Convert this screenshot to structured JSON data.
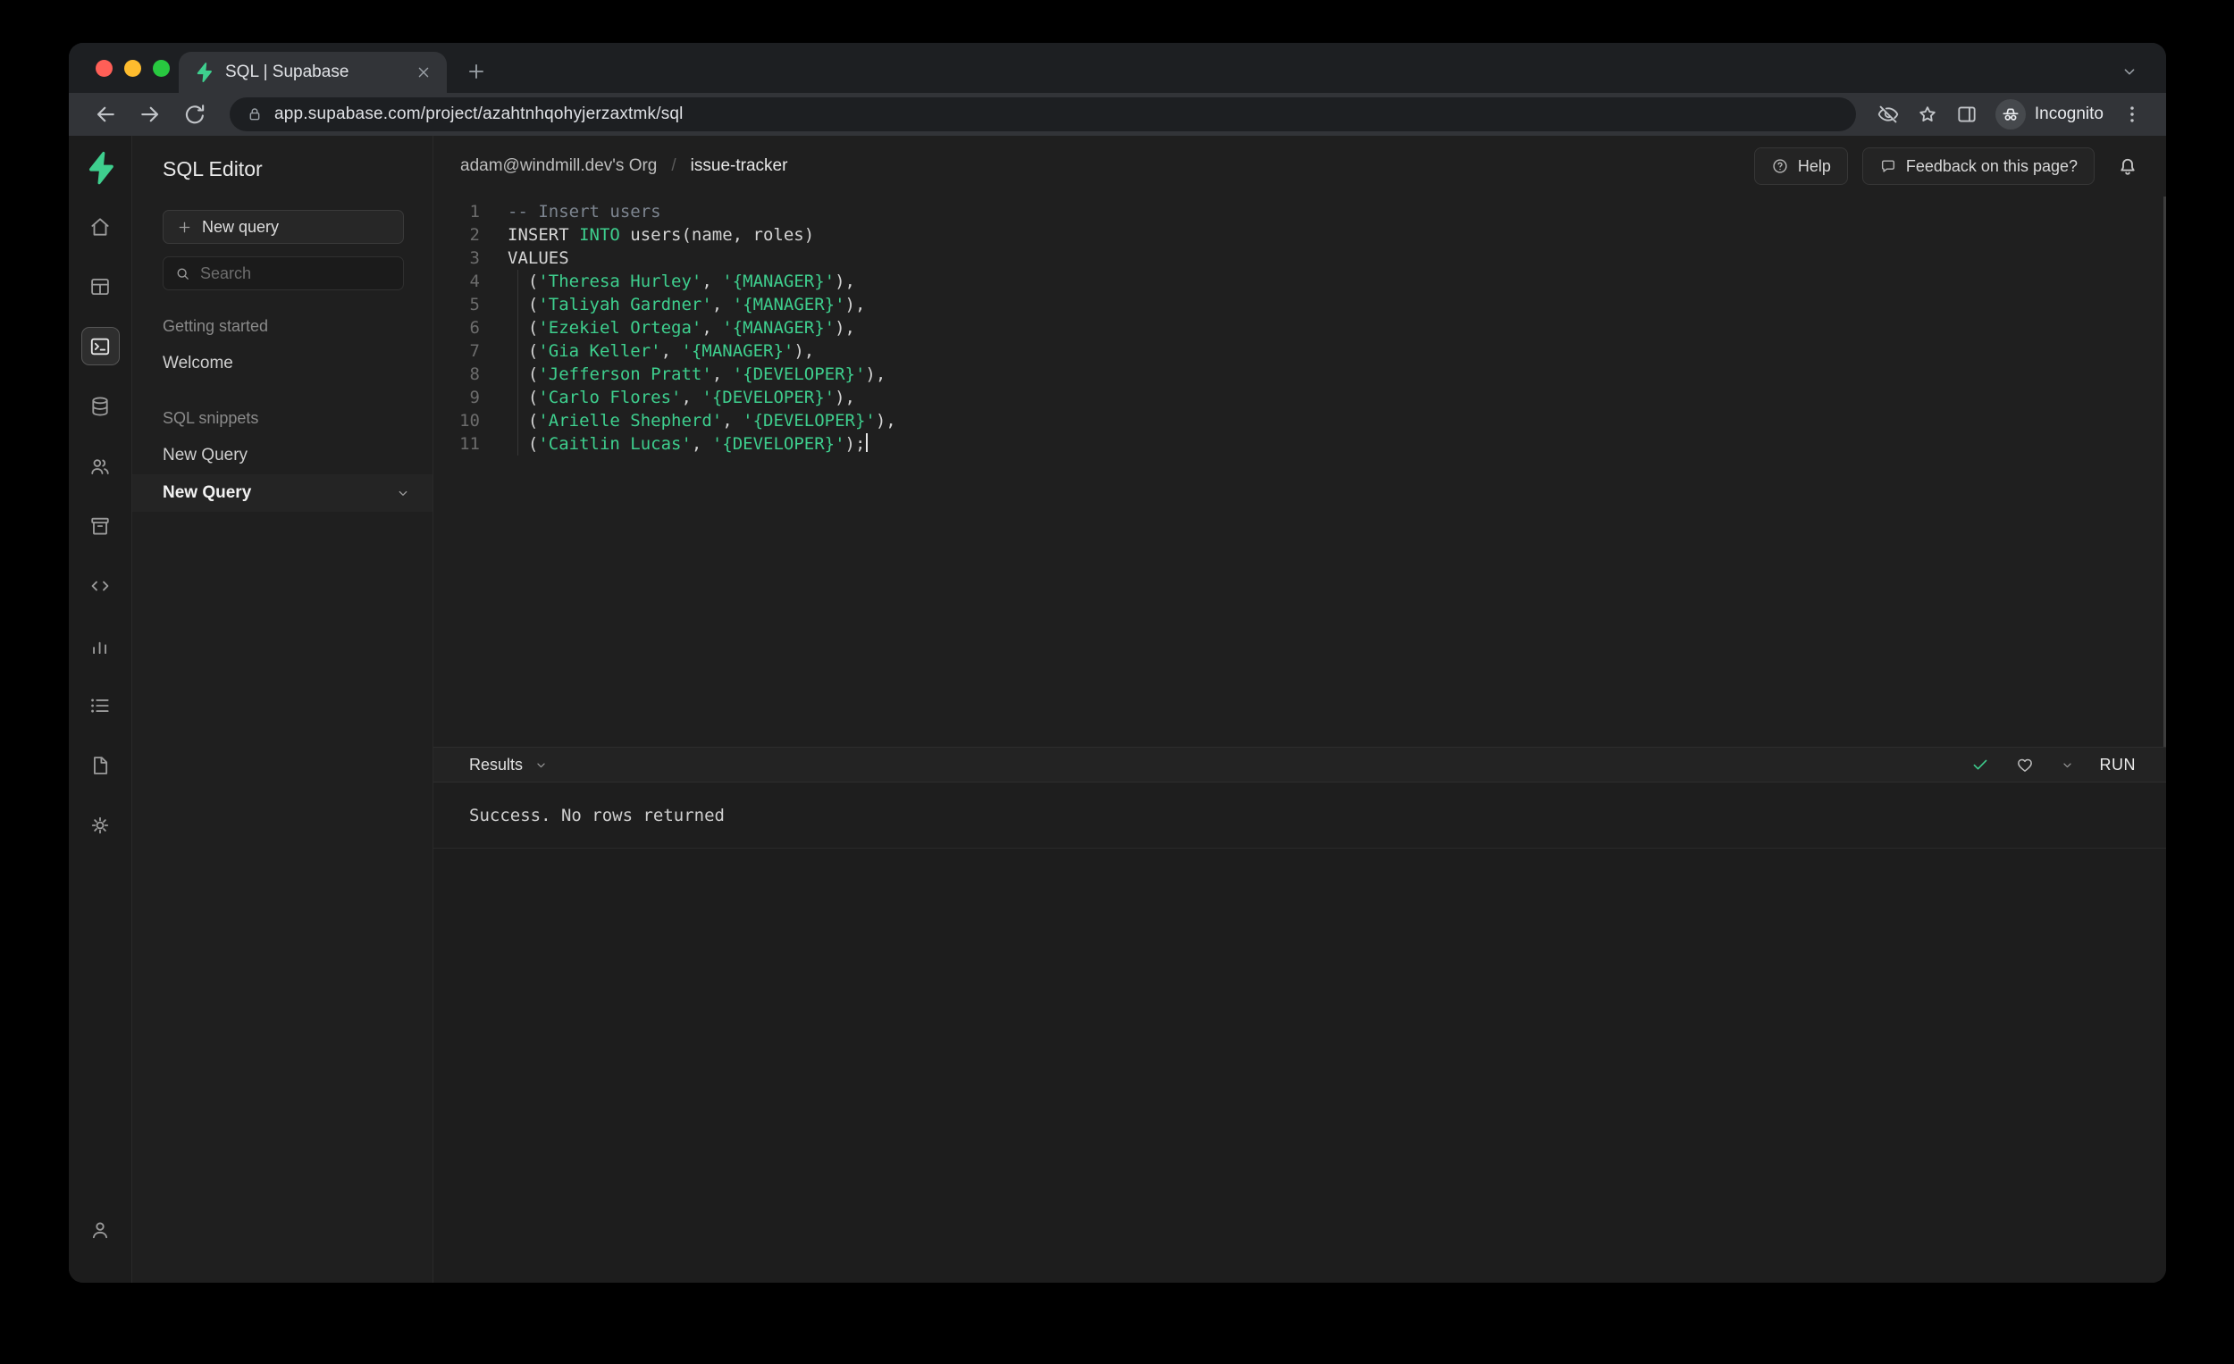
{
  "browser": {
    "tab_title": "SQL | Supabase",
    "url": "app.supabase.com/project/azahtnhqohyjerzaxtmk/sql",
    "incognito_label": "Incognito"
  },
  "rail": {
    "items": [
      {
        "name": "home"
      },
      {
        "name": "table-editor"
      },
      {
        "name": "sql-editor",
        "selected": true
      },
      {
        "name": "database"
      },
      {
        "name": "authentication"
      },
      {
        "name": "storage"
      },
      {
        "name": "api"
      },
      {
        "name": "reports"
      },
      {
        "name": "logs"
      },
      {
        "name": "docs"
      },
      {
        "name": "settings"
      }
    ]
  },
  "sidebar": {
    "title": "SQL Editor",
    "new_query_button": "New query",
    "search_placeholder": "Search",
    "sections": [
      {
        "label": "Getting started",
        "items": [
          {
            "label": "Welcome",
            "selected": false
          }
        ]
      },
      {
        "label": "SQL snippets",
        "items": [
          {
            "label": "New Query",
            "selected": false
          },
          {
            "label": "New Query",
            "selected": true
          }
        ]
      }
    ]
  },
  "topbar": {
    "org": "adam@windmill.dev's Org",
    "project": "issue-tracker",
    "help_label": "Help",
    "feedback_label": "Feedback on this page?"
  },
  "editor": {
    "cursor_line": 11,
    "lines": [
      [
        [
          "-- Insert users",
          "c"
        ]
      ],
      [
        [
          "INSERT ",
          "k"
        ],
        [
          "INTO",
          "g"
        ],
        [
          " users(name, roles)",
          "p"
        ]
      ],
      [
        [
          "VALUES",
          "k"
        ]
      ],
      [
        [
          "  (",
          "p"
        ],
        [
          "'Theresa Hurley'",
          "s"
        ],
        [
          ", ",
          "p"
        ],
        [
          "'{MANAGER}'",
          "s"
        ],
        [
          "),",
          "p"
        ]
      ],
      [
        [
          "  (",
          "p"
        ],
        [
          "'Taliyah Gardner'",
          "s"
        ],
        [
          ", ",
          "p"
        ],
        [
          "'{MANAGER}'",
          "s"
        ],
        [
          "),",
          "p"
        ]
      ],
      [
        [
          "  (",
          "p"
        ],
        [
          "'Ezekiel Ortega'",
          "s"
        ],
        [
          ", ",
          "p"
        ],
        [
          "'{MANAGER}'",
          "s"
        ],
        [
          "),",
          "p"
        ]
      ],
      [
        [
          "  (",
          "p"
        ],
        [
          "'Gia Keller'",
          "s"
        ],
        [
          ", ",
          "p"
        ],
        [
          "'{MANAGER}'",
          "s"
        ],
        [
          "),",
          "p"
        ]
      ],
      [
        [
          "  (",
          "p"
        ],
        [
          "'Jefferson Pratt'",
          "s"
        ],
        [
          ", ",
          "p"
        ],
        [
          "'{DEVELOPER}'",
          "s"
        ],
        [
          "),",
          "p"
        ]
      ],
      [
        [
          "  (",
          "p"
        ],
        [
          "'Carlo Flores'",
          "s"
        ],
        [
          ", ",
          "p"
        ],
        [
          "'{DEVELOPER}'",
          "s"
        ],
        [
          "),",
          "p"
        ]
      ],
      [
        [
          "  (",
          "p"
        ],
        [
          "'Arielle Shepherd'",
          "s"
        ],
        [
          ", ",
          "p"
        ],
        [
          "'{DEVELOPER}'",
          "s"
        ],
        [
          "),",
          "p"
        ]
      ],
      [
        [
          "  (",
          "p"
        ],
        [
          "'Caitlin Lucas'",
          "s"
        ],
        [
          ", ",
          "p"
        ],
        [
          "'{DEVELOPER}'",
          "s"
        ],
        [
          ");",
          "p"
        ]
      ]
    ]
  },
  "results": {
    "label": "Results",
    "run_label": "RUN",
    "message": "Success. No rows returned"
  },
  "colors": {
    "brand": "#3ecf8e"
  }
}
